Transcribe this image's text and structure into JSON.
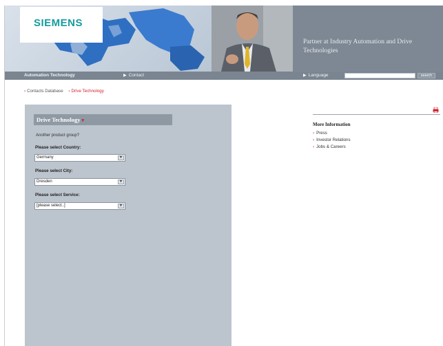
{
  "header": {
    "logo": "SIEMENS",
    "tagline": "Partner at Industry Automation and Drive Technologies"
  },
  "navbar": {
    "automation": "Automation Technology",
    "contact": "Contact",
    "language": "Language",
    "search_button": "search"
  },
  "breadcrumb": {
    "items": [
      "Contacts Database",
      "Drive Technology"
    ]
  },
  "panel": {
    "title": "Drive Technology",
    "another": "Another product group?",
    "country_label": "Please select Country:",
    "country_value": "Germany",
    "city_label": "Please select City:",
    "city_value": "Dresden",
    "service_label": "Please select Service:",
    "service_value": "[please select..]"
  },
  "right": {
    "more_info_title": "More Information",
    "links": [
      "Press",
      "Investor Relations",
      "Jobs & Careers"
    ]
  },
  "colors": {
    "accent_red": "#d1242f",
    "logo_teal": "#149c9e",
    "panel_gray": "#bcc4cd",
    "nav_gray": "#7a8591"
  },
  "icons": [
    "dropdown-caret-icon",
    "print-icon",
    "arrow-icon"
  ]
}
